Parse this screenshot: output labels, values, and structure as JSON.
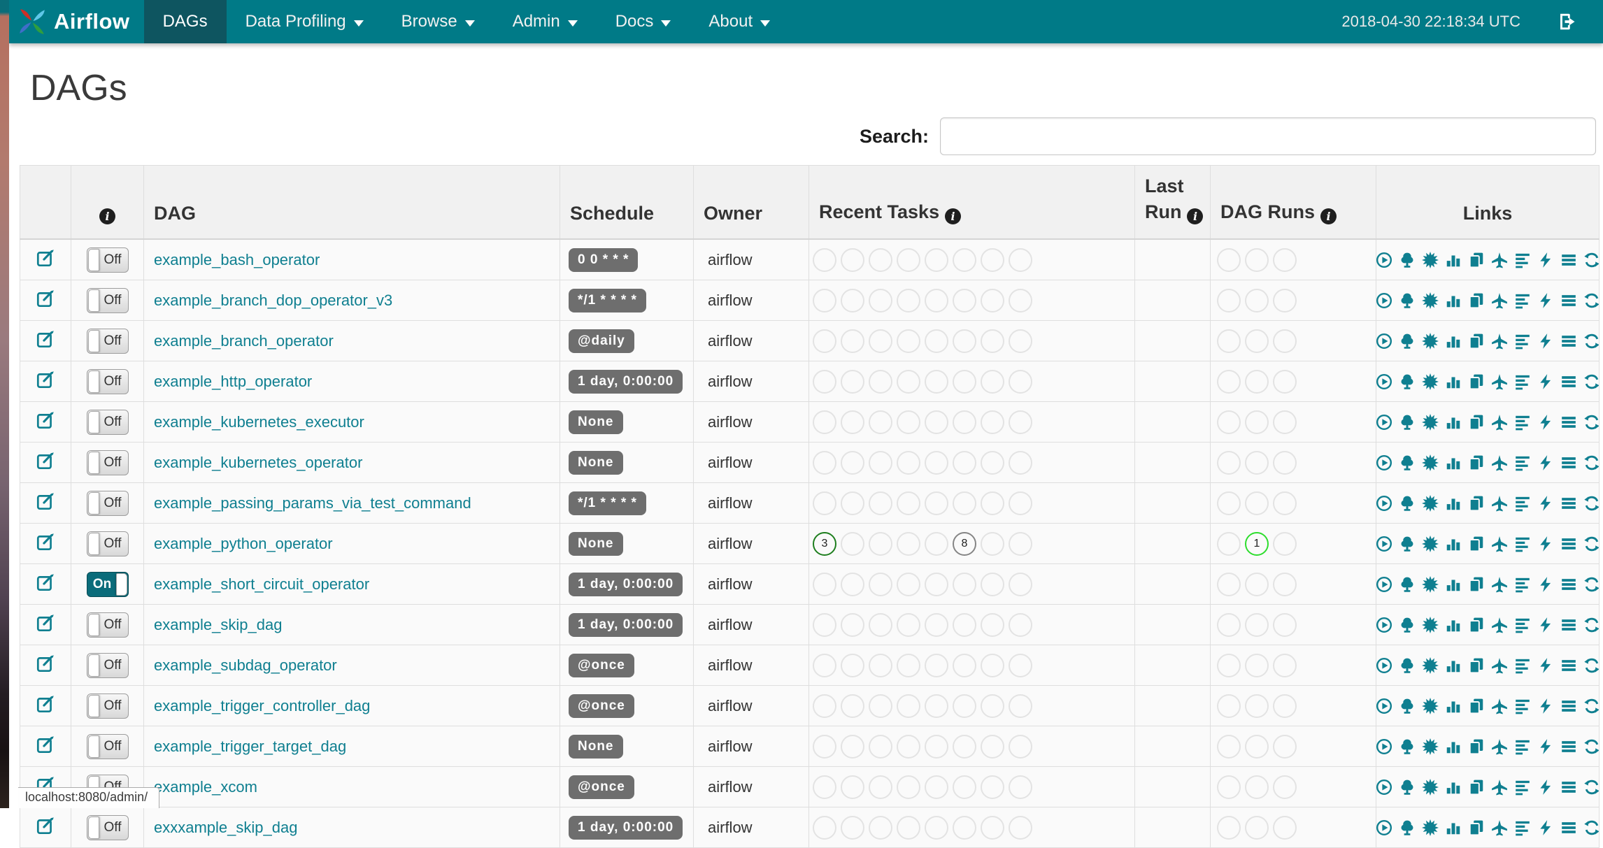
{
  "navbar": {
    "brand": "Airflow",
    "items": [
      {
        "label": "DAGs",
        "active": true,
        "caret": false
      },
      {
        "label": "Data Profiling",
        "active": false,
        "caret": true
      },
      {
        "label": "Browse",
        "active": false,
        "caret": true
      },
      {
        "label": "Admin",
        "active": false,
        "caret": true
      },
      {
        "label": "Docs",
        "active": false,
        "caret": true
      },
      {
        "label": "About",
        "active": false,
        "caret": true
      }
    ],
    "clock": "2018-04-30 22:18:34 UTC"
  },
  "page": {
    "title": "DAGs",
    "search_label": "Search:",
    "search_value": "",
    "status_tooltip": "localhost:8080/admin/"
  },
  "table": {
    "headers": {
      "edit": "",
      "dag": "DAG",
      "schedule": "Schedule",
      "owner": "Owner",
      "recent_tasks": "Recent Tasks",
      "last_run": "Last Run",
      "dag_runs": "DAG Runs",
      "links": "Links"
    },
    "recent_task_slots": 8,
    "dag_run_slots": 3,
    "rows": [
      {
        "name": "example_bash_operator",
        "toggle": "Off",
        "schedule": "0 0 * * *",
        "owner": "airflow",
        "last_run": "",
        "recent_tasks": [],
        "dag_runs": []
      },
      {
        "name": "example_branch_dop_operator_v3",
        "toggle": "Off",
        "schedule": "*/1 * * * *",
        "owner": "airflow",
        "last_run": "",
        "recent_tasks": [],
        "dag_runs": []
      },
      {
        "name": "example_branch_operator",
        "toggle": "Off",
        "schedule": "@daily",
        "owner": "airflow",
        "last_run": "",
        "recent_tasks": [],
        "dag_runs": []
      },
      {
        "name": "example_http_operator",
        "toggle": "Off",
        "schedule": "1 day, 0:00:00",
        "owner": "airflow",
        "last_run": "",
        "recent_tasks": [],
        "dag_runs": []
      },
      {
        "name": "example_kubernetes_executor",
        "toggle": "Off",
        "schedule": "None",
        "owner": "airflow",
        "last_run": "",
        "recent_tasks": [],
        "dag_runs": []
      },
      {
        "name": "example_kubernetes_operator",
        "toggle": "Off",
        "schedule": "None",
        "owner": "airflow",
        "last_run": "",
        "recent_tasks": [],
        "dag_runs": []
      },
      {
        "name": "example_passing_params_via_test_command",
        "toggle": "Off",
        "schedule": "*/1 * * * *",
        "owner": "airflow",
        "last_run": "",
        "recent_tasks": [],
        "dag_runs": []
      },
      {
        "name": "example_python_operator",
        "toggle": "Off",
        "schedule": "None",
        "owner": "airflow",
        "last_run": "",
        "recent_tasks": [
          {
            "slot": 0,
            "count": "3",
            "state": "success"
          },
          {
            "slot": 5,
            "count": "8",
            "state": "queued"
          }
        ],
        "dag_runs": [
          {
            "slot": 1,
            "count": "1",
            "state": "running"
          }
        ]
      },
      {
        "name": "example_short_circuit_operator",
        "toggle": "On",
        "schedule": "1 day, 0:00:00",
        "owner": "airflow",
        "last_run": "",
        "recent_tasks": [],
        "dag_runs": []
      },
      {
        "name": "example_skip_dag",
        "toggle": "Off",
        "schedule": "1 day, 0:00:00",
        "owner": "airflow",
        "last_run": "",
        "recent_tasks": [],
        "dag_runs": []
      },
      {
        "name": "example_subdag_operator",
        "toggle": "Off",
        "schedule": "@once",
        "owner": "airflow",
        "last_run": "",
        "recent_tasks": [],
        "dag_runs": []
      },
      {
        "name": "example_trigger_controller_dag",
        "toggle": "Off",
        "schedule": "@once",
        "owner": "airflow",
        "last_run": "",
        "recent_tasks": [],
        "dag_runs": []
      },
      {
        "name": "example_trigger_target_dag",
        "toggle": "Off",
        "schedule": "None",
        "owner": "airflow",
        "last_run": "",
        "recent_tasks": [],
        "dag_runs": []
      },
      {
        "name": "example_xcom",
        "toggle": "Off",
        "schedule": "@once",
        "owner": "airflow",
        "last_run": "",
        "recent_tasks": [],
        "dag_runs": []
      },
      {
        "name": "exxxample_skip_dag",
        "toggle": "Off",
        "schedule": "1 day, 0:00:00",
        "owner": "airflow",
        "last_run": "",
        "recent_tasks": [],
        "dag_runs": []
      }
    ]
  },
  "links": {
    "icons": [
      "trigger-play-circle",
      "tree-view",
      "graph-view-sunburst",
      "task-duration-chart",
      "task-tries-copy",
      "landing-times-plane",
      "gantt-align",
      "code-bolt",
      "logs-list",
      "refresh"
    ]
  },
  "colors": {
    "navbar_bg": "#007a87",
    "navbar_active_bg": "#0e5560",
    "link_teal": "#0f7f90",
    "badge_bg": "#6e6e6e",
    "empty_circle": "#e3e3e3",
    "states": {
      "success": "#1e7e1e",
      "queued": "#858585",
      "running": "#2ddd2d"
    }
  }
}
